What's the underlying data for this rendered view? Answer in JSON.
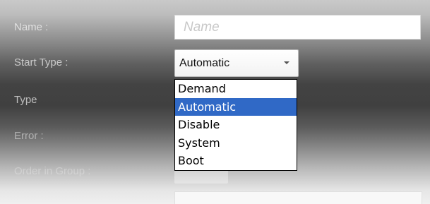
{
  "form": {
    "name_label": "Name :",
    "name_placeholder": "Name",
    "start_type_label": "Start Type :",
    "start_type_value": "Automatic",
    "type_label": "Type",
    "error_label": "Error :",
    "order_label": "Order in Group :"
  },
  "dropdown": {
    "options": [
      "Demand",
      "Automatic",
      "Disable",
      "System",
      "Boot"
    ],
    "selected": "Automatic"
  }
}
